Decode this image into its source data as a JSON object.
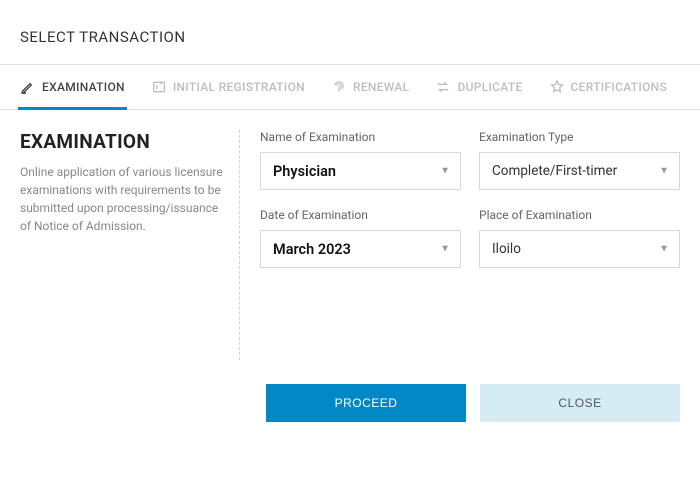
{
  "pageTitle": "SELECT TRANSACTION",
  "tabs": [
    {
      "label": "EXAMINATION"
    },
    {
      "label": "INITIAL REGISTRATION"
    },
    {
      "label": "RENEWAL"
    },
    {
      "label": "DUPLICATE"
    },
    {
      "label": "CERTIFICATIONS"
    }
  ],
  "panel": {
    "heading": "EXAMINATION",
    "description": "Online application of various licensure examinations with requirements to be submitted upon processing/issuance of Notice of Admission."
  },
  "form": {
    "name": {
      "label": "Name of Examination",
      "value": "Physician"
    },
    "type": {
      "label": "Examination Type",
      "value": "Complete/First-timer"
    },
    "date": {
      "label": "Date of Examination",
      "value": "March 2023"
    },
    "place": {
      "label": "Place of Examination",
      "value": "Iloilo"
    }
  },
  "buttons": {
    "proceed": "PROCEED",
    "close": "CLOSE"
  }
}
